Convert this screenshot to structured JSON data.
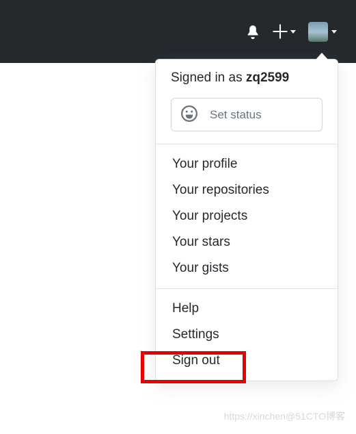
{
  "header": {
    "bell_icon": "notifications",
    "plus_icon": "create-new",
    "avatar_alt": "user avatar"
  },
  "dropdown": {
    "signed_in_prefix": "Signed in as ",
    "username": "zq2599",
    "status_label": "Set status",
    "section1": [
      "Your profile",
      "Your repositories",
      "Your projects",
      "Your stars",
      "Your gists"
    ],
    "section2": [
      "Help",
      "Settings",
      "Sign out"
    ]
  },
  "watermark": "https://xinchen@51CTO博客"
}
